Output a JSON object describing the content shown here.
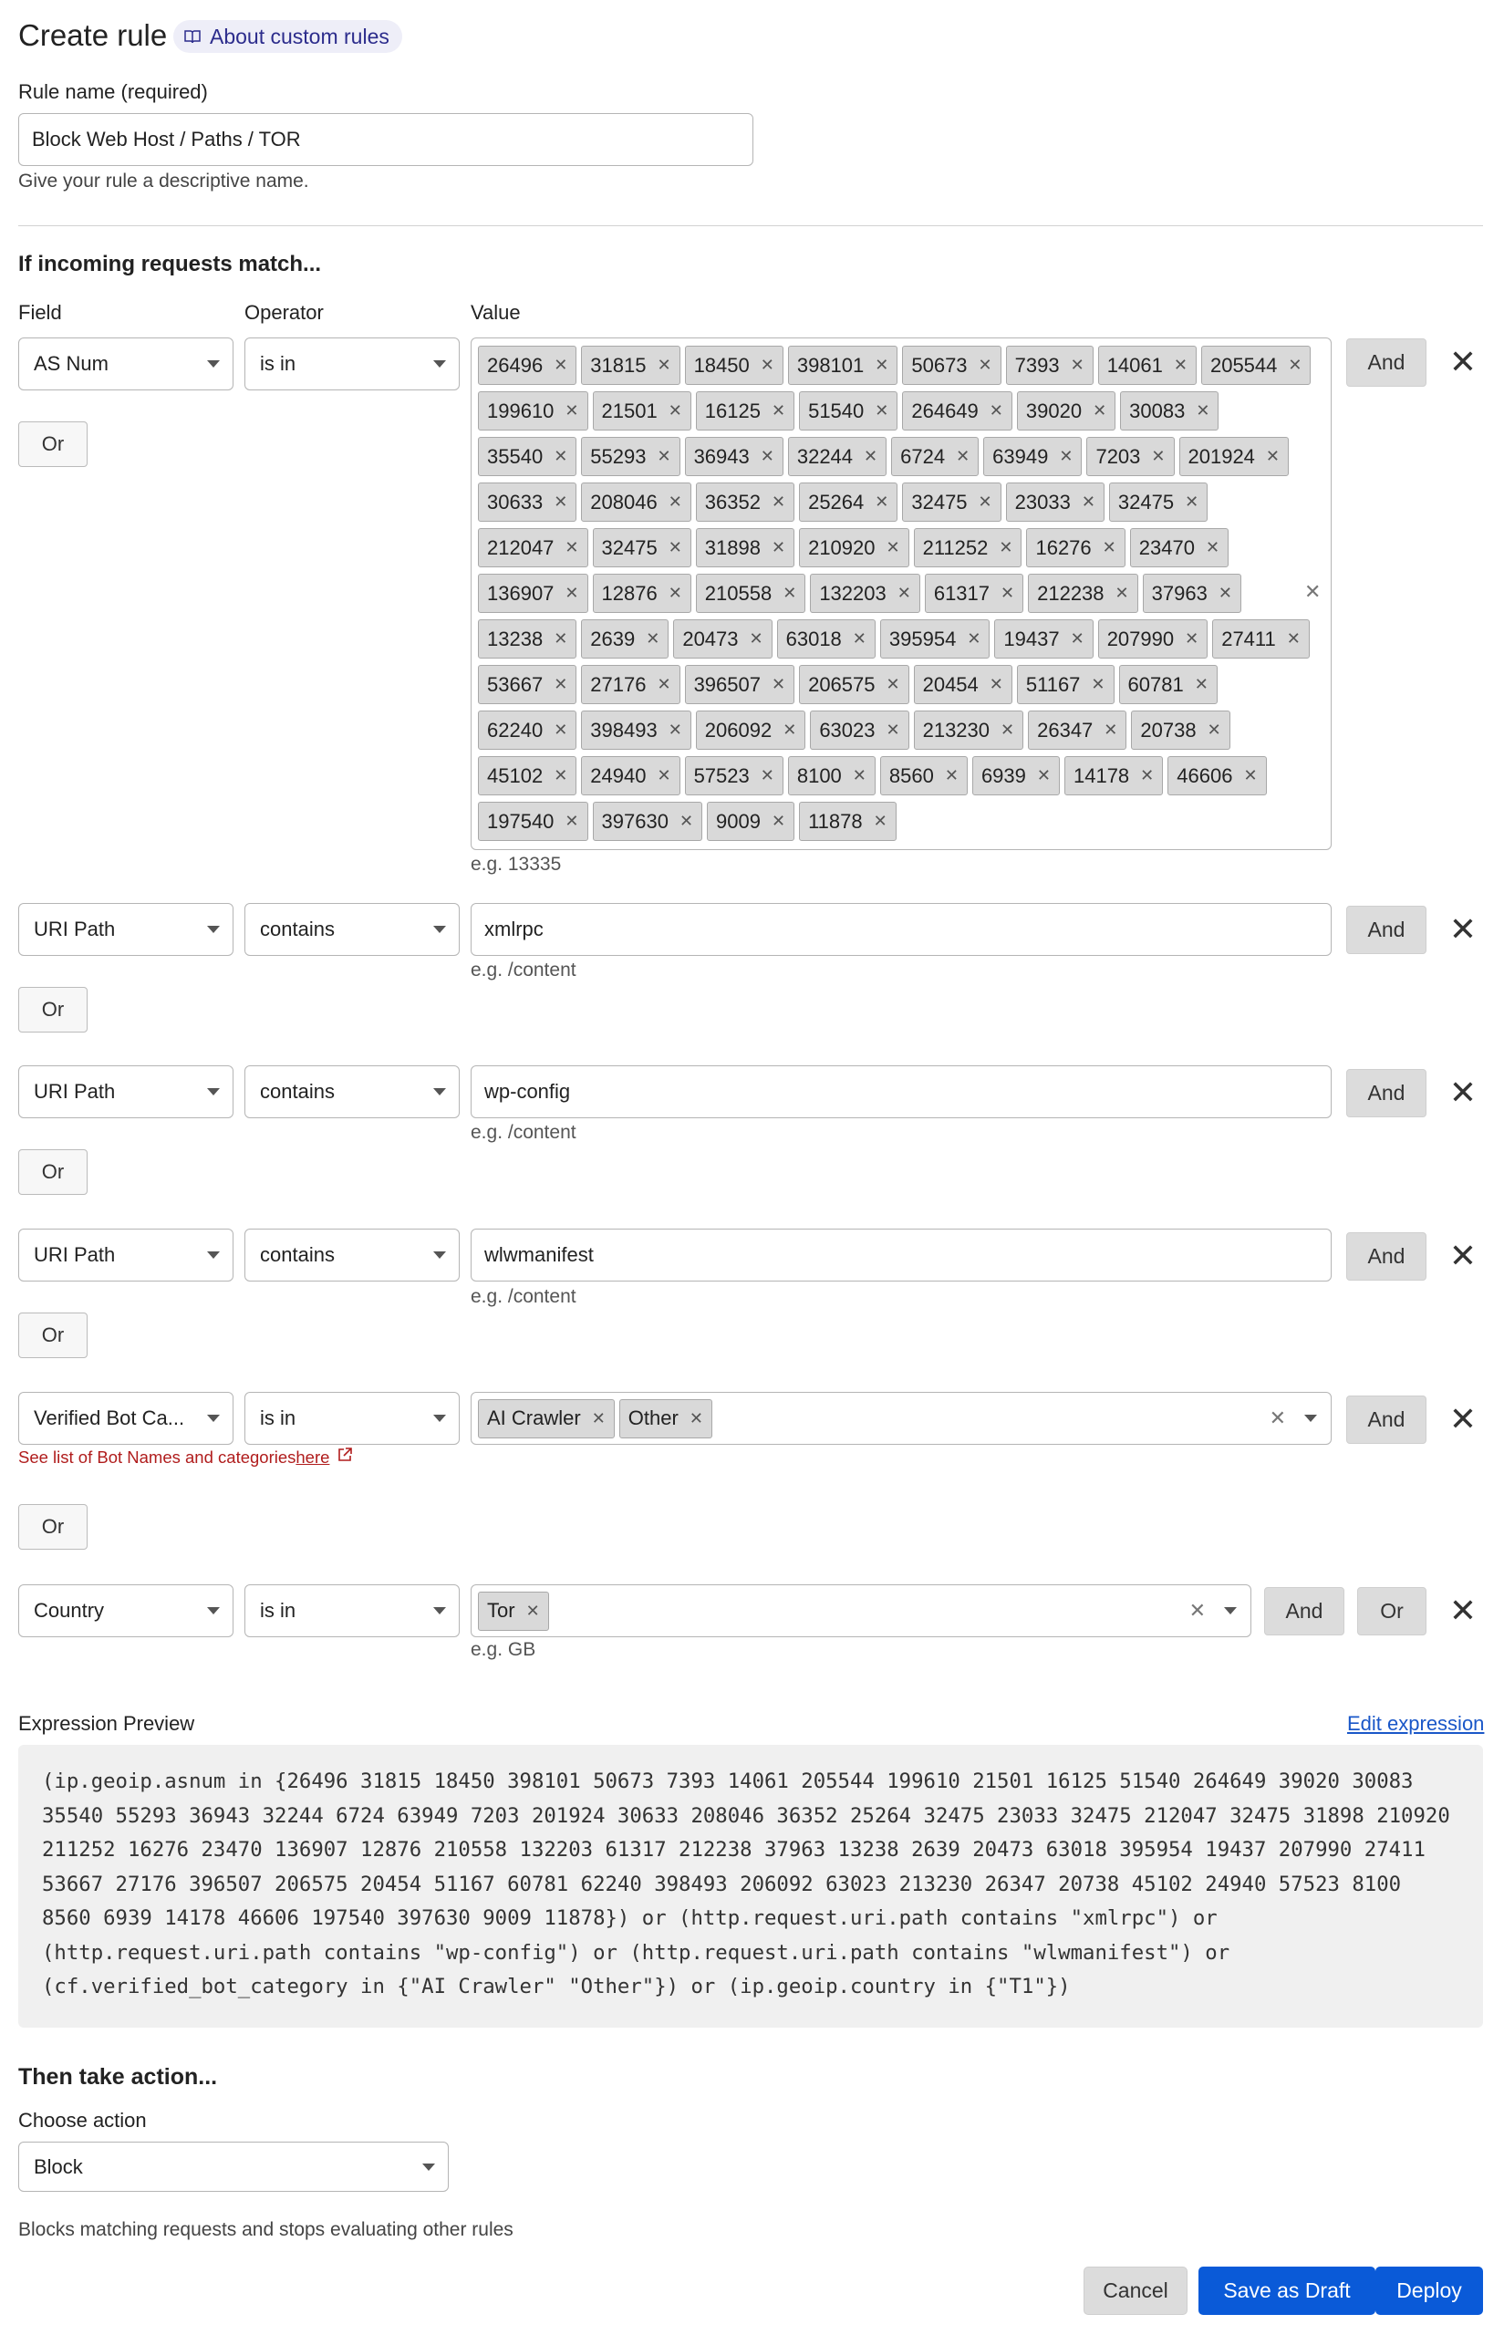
{
  "header": {
    "title": "Create rule",
    "about_link": "About custom rules"
  },
  "rule_name": {
    "label": "Rule name (required)",
    "value": "Block Web Host / Paths / TOR",
    "help": "Give your rule a descriptive name."
  },
  "match": {
    "heading": "If incoming requests match...",
    "field_header": "Field",
    "operator_header": "Operator",
    "value_header": "Value",
    "and_label": "And",
    "or_label": "Or",
    "conditions": [
      {
        "field": "AS Num",
        "operator": "is in",
        "example": "e.g. 13335",
        "chip_rows": [
          [
            "26496",
            "31815",
            "18450",
            "398101",
            "50673",
            "7393",
            "14061",
            "205544"
          ],
          [
            "199610",
            "21501",
            "16125",
            "51540",
            "264649",
            "39020",
            "30083"
          ],
          [
            "35540",
            "55293",
            "36943",
            "32244",
            "6724",
            "63949",
            "7203",
            "201924"
          ],
          [
            "30633",
            "208046",
            "36352",
            "25264",
            "32475",
            "23033",
            "32475"
          ],
          [
            "212047",
            "32475",
            "31898",
            "210920",
            "211252",
            "16276",
            "23470"
          ],
          [
            "136907",
            "12876",
            "210558",
            "132203",
            "61317",
            "212238",
            "37963"
          ],
          [
            "13238",
            "2639",
            "20473",
            "63018",
            "395954",
            "19437",
            "207990",
            "27411"
          ],
          [
            "53667",
            "27176",
            "396507",
            "206575",
            "20454",
            "51167",
            "60781"
          ],
          [
            "62240",
            "398493",
            "206092",
            "63023",
            "213230",
            "26347",
            "20738"
          ],
          [
            "45102",
            "24940",
            "57523",
            "8100",
            "8560",
            "6939",
            "14178",
            "46606"
          ],
          [
            "197540",
            "397630",
            "9009",
            "11878"
          ]
        ]
      },
      {
        "field": "URI Path",
        "operator": "contains",
        "value": "xmlrpc",
        "example": "e.g. /content"
      },
      {
        "field": "URI Path",
        "operator": "contains",
        "value": "wp-config",
        "example": "e.g. /content"
      },
      {
        "field": "URI Path",
        "operator": "contains",
        "value": "wlwmanifest",
        "example": "e.g. /content"
      },
      {
        "field": "Verified Bot Ca...",
        "operator": "is in",
        "chips": [
          "AI Crawler",
          "Other"
        ],
        "note_prefix": "See list of Bot Names and categories ",
        "note_link": "here"
      },
      {
        "field": "Country",
        "operator": "is in",
        "chips": [
          "Tor"
        ],
        "example": "e.g. GB"
      }
    ]
  },
  "preview": {
    "label": "Expression Preview",
    "edit_link": "Edit expression",
    "lines": [
      "(ip.geoip.asnum in {26496 31815 18450 398101 50673 7393 14061 205544 199610 21501 16125 51540 264649 39020 30083",
      "35540 55293 36943 32244 6724 63949 7203 201924 30633 208046 36352 25264 32475 23033 32475 212047 32475 31898 210920",
      "211252 16276 23470 136907 12876 210558 132203 61317 212238 37963 13238 2639 20473 63018 395954 19437 207990 27411",
      "53667 27176 396507 206575 20454 51167 60781 62240 398493 206092 63023 213230 26347 20738 45102 24940 57523 8100",
      "8560 6939 14178 46606 197540 397630 9009 11878}) or (http.request.uri.path contains \"xmlrpc\") or",
      "(http.request.uri.path contains \"wp-config\") or (http.request.uri.path contains \"wlwmanifest\") or",
      "(cf.verified_bot_category in {\"AI Crawler\" \"Other\"}) or (ip.geoip.country in {\"T1\"})"
    ]
  },
  "action": {
    "heading": "Then take action...",
    "choose_label": "Choose action",
    "selected": "Block",
    "description": "Blocks matching requests and stops evaluating other rules"
  },
  "footer": {
    "cancel": "Cancel",
    "save_draft": "Save as Draft",
    "deploy": "Deploy"
  },
  "colors": {
    "primary": "#0a5ad8",
    "note_red": "#b01c1c",
    "pill_bg": "#eeeef8"
  }
}
